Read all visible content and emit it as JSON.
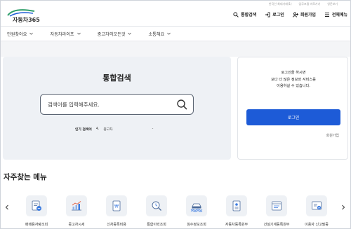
{
  "util_links": [
    "한국인 최대거래(1)",
    "업무포털 바로가기",
    "영문보기"
  ],
  "logo": {
    "text": "자동차365"
  },
  "gnb": [
    {
      "name": "integrated-search",
      "label": "통합검색"
    },
    {
      "name": "login",
      "label": "로그인"
    },
    {
      "name": "signup",
      "label": "회원가입"
    },
    {
      "name": "all-menu",
      "label": "전체메뉴"
    }
  ],
  "nav": [
    "민원찾아요",
    "자동차라이프",
    "중고차의모든것",
    "소통해요"
  ],
  "search": {
    "title": "통합검색",
    "placeholder": "검색어를 입력해주세요.",
    "popular_label": "인기 검색어",
    "popular_rank": "4.",
    "popular_keyword": "중고차",
    "popular_dash": "-"
  },
  "login": {
    "line1": "로그인을 하시면",
    "line2": "보다 더 많은 정보와 서비스를",
    "line3": "이용하실 수 있습니다.",
    "button": "로그인",
    "join": "회원가입"
  },
  "frequent": {
    "title": "자주찾는 메뉴",
    "items": [
      {
        "icon": "car-document-icon",
        "label": "매매용자량조회"
      },
      {
        "icon": "chart-icon",
        "label": "중고차시세"
      },
      {
        "icon": "won-document-icon",
        "label": "신차등록비용"
      },
      {
        "icon": "search-history-icon",
        "label": "통합이력조회"
      },
      {
        "icon": "flood-car-icon",
        "label": "침수정보조회"
      },
      {
        "icon": "registration-doc-icon",
        "label": "자동차등록원부"
      },
      {
        "icon": "machine-doc-icon",
        "label": "건설기계등록원부"
      },
      {
        "icon": "certificate-icon",
        "label": "이용자 신고필증"
      }
    ]
  },
  "colors": {
    "primary": "#1d5bd7",
    "panel": "#eef1f5",
    "accent_icon": "#3b7be0"
  }
}
